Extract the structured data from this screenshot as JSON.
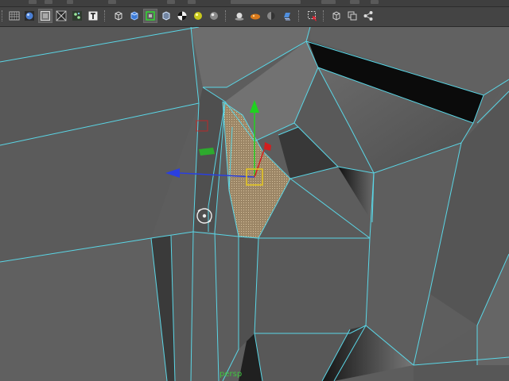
{
  "toolbar": {
    "buttons": [
      {
        "name": "shaded-wireframe-icon",
        "pressed": false
      },
      {
        "name": "smooth-shade-icon",
        "pressed": false
      },
      {
        "name": "shade-selected-icon",
        "pressed": true
      },
      {
        "name": "wireframe-on-shaded-icon",
        "pressed": false
      },
      {
        "name": "texture-display-icon",
        "pressed": false
      },
      {
        "name": "text-icon",
        "pressed": false
      },
      {
        "name": "bounding-box-icon",
        "pressed": false
      },
      {
        "name": "default-material-icon",
        "pressed": false
      },
      {
        "name": "isolate-select-icon",
        "pressed": true
      },
      {
        "name": "xray-icon",
        "pressed": false
      },
      {
        "name": "checker-icon",
        "pressed": false
      },
      {
        "name": "sphere-light-icon",
        "pressed": false
      },
      {
        "name": "grey-sphere-icon",
        "pressed": false
      },
      {
        "name": "camera-lights-icon",
        "pressed": false
      },
      {
        "name": "shadows-icon",
        "pressed": false
      },
      {
        "name": "ambient-occlusion-icon",
        "pressed": false
      },
      {
        "name": "motion-blur-icon",
        "pressed": false
      },
      {
        "name": "select-camera-icon",
        "pressed": false
      },
      {
        "name": "two-pane-icon",
        "pressed": false
      },
      {
        "name": "four-pane-icon",
        "pressed": false
      },
      {
        "name": "share-icon",
        "pressed": false
      }
    ]
  },
  "viewport": {
    "camera_label": "persp",
    "wire_color": "#5ad6e6",
    "manipulator": {
      "y_axis_color": "#1fd21f",
      "x_axis_color": "#2a3fe0",
      "z_axis_color": "#d21f1f",
      "center_color": "#e6c81e"
    }
  }
}
